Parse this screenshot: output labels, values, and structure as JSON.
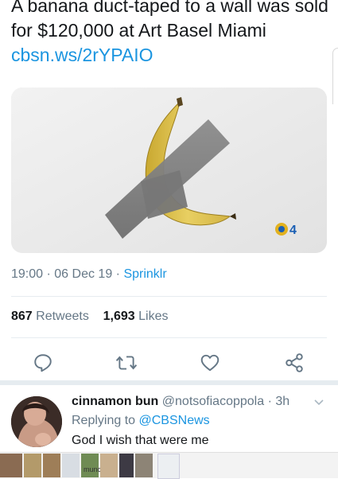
{
  "tweet": {
    "text": "A banana duct-taped to a wall was sold for $120,000 at Art Basel Miami",
    "link": "cbsn.ws/2rYPAIO",
    "time": "19:00",
    "dot": "·",
    "date": "06 Dec 19",
    "source": "Sprinklr"
  },
  "media": {
    "watermark_number": "4"
  },
  "stats": {
    "retweets_count": "867",
    "retweets_label": "Retweets",
    "likes_count": "1,693",
    "likes_label": "Likes"
  },
  "actions": [
    "reply-icon",
    "retweet-icon",
    "like-icon",
    "share-icon"
  ],
  "reply": {
    "name": "cinnamon bun",
    "handle": "@notsofiacoppola",
    "dot": "·",
    "time": "3h",
    "replying_prefix": "Replying to",
    "replying_handle": "@CBSNews",
    "text": "God I wish that were me"
  },
  "tray": {
    "thumb_text": "munc"
  },
  "colors": {
    "link": "#1b95e0",
    "secondary_text": "#657786",
    "primary_text": "#14171a",
    "divider": "#e6ecf0"
  }
}
